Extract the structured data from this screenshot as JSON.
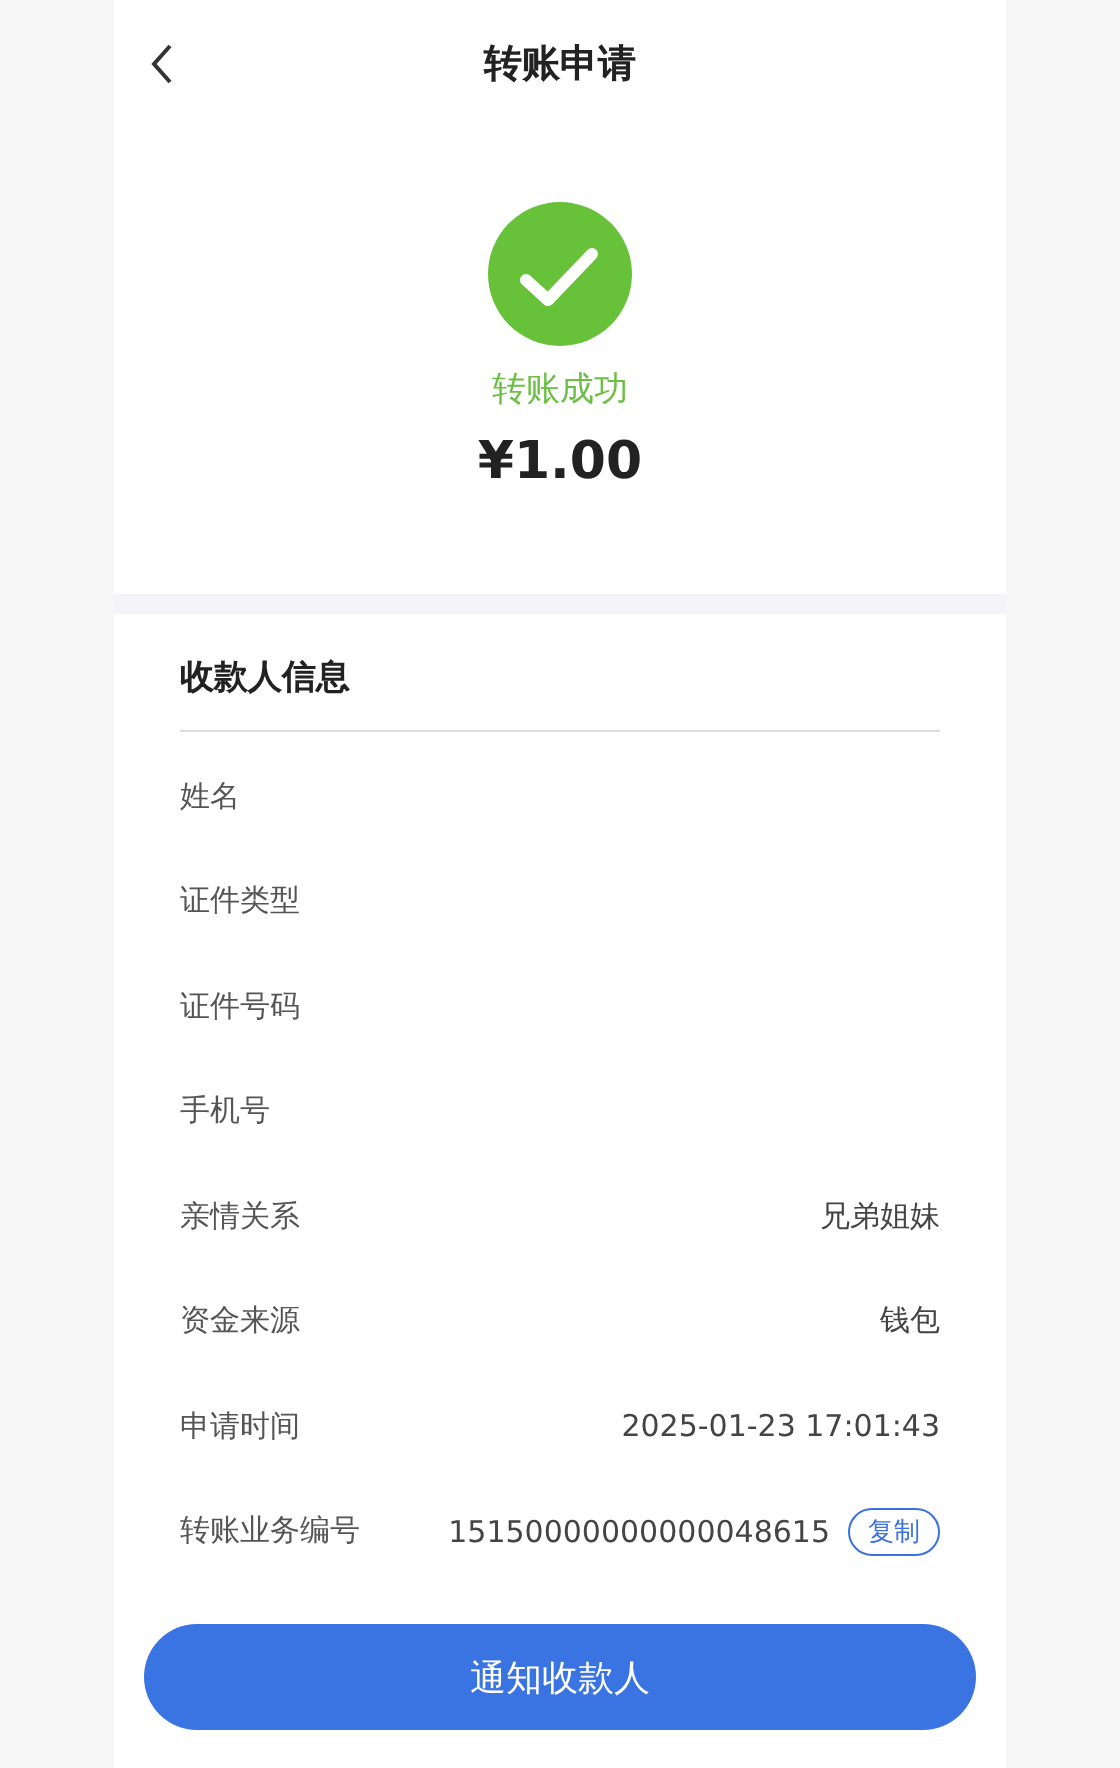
{
  "header": {
    "title": "转账申请"
  },
  "result": {
    "status": "转账成功",
    "amount": "¥1.00"
  },
  "payee_section": {
    "title": "收款人信息",
    "rows": [
      {
        "label": "姓名"
      },
      {
        "label": "证件类型"
      },
      {
        "label": "证件号码"
      },
      {
        "label": "手机号"
      },
      {
        "label": "亲情关系",
        "value": "兄弟姐妹"
      },
      {
        "label": "资金来源",
        "value": "钱包"
      },
      {
        "label": "申请时间",
        "value": "2025-01-23 17:01:43"
      },
      {
        "label": "转账业务编号",
        "value": "15150000000000048615",
        "action": "复制"
      }
    ]
  },
  "primary_button": "通知收款人"
}
